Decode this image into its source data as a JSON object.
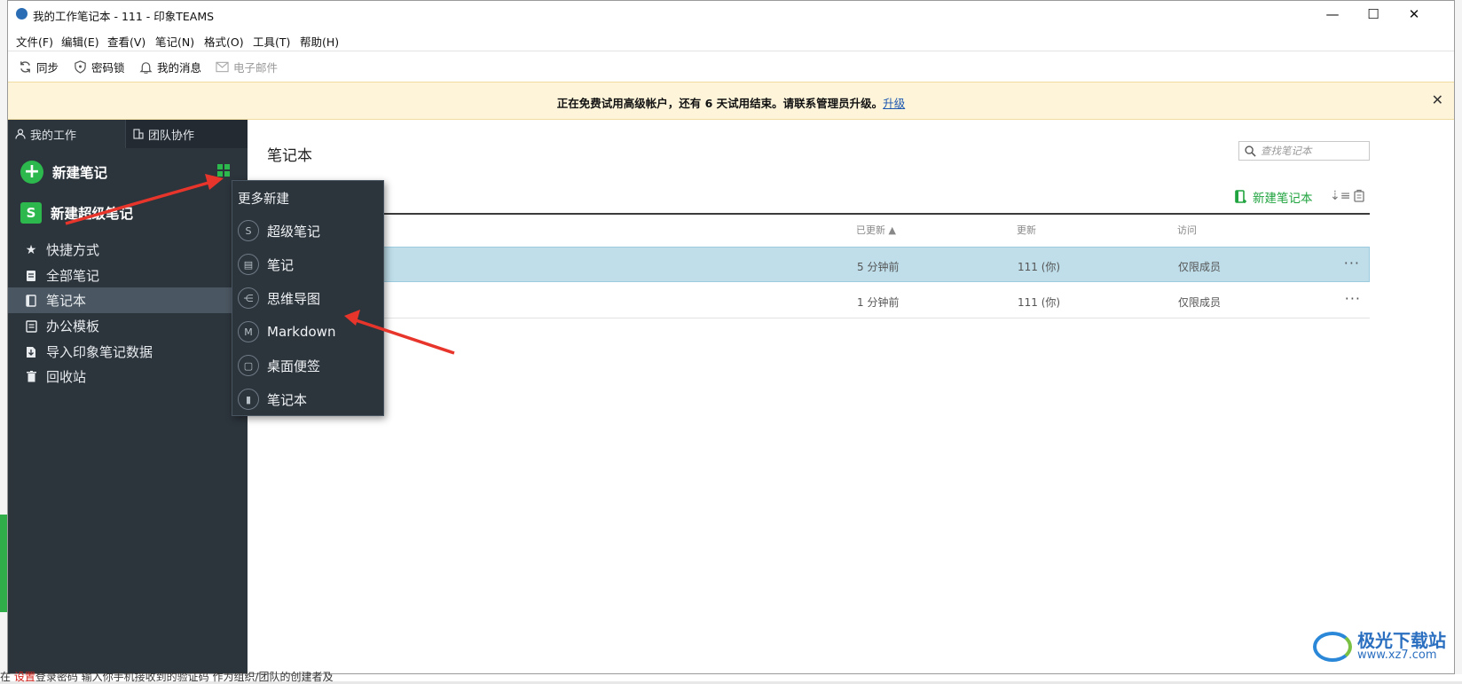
{
  "window": {
    "title": "我的工作笔记本 - 111 - 印象TEAMS",
    "controls": {
      "minimize": "—",
      "maximize": "☐",
      "close": "✕"
    }
  },
  "menubar": {
    "items": [
      "文件(F)",
      "编辑(E)",
      "查看(V)",
      "笔记(N)",
      "格式(O)",
      "工具(T)",
      "帮助(H)"
    ]
  },
  "toolbar": {
    "sync": "同步",
    "password_lock": "密码锁",
    "my_messages": "我的消息",
    "email": "电子邮件"
  },
  "banner": {
    "message": "正在免费试用高级帐户，还有 6 天试用结束。请联系管理员升级。",
    "link": "升级"
  },
  "sidebar": {
    "tabs": [
      "我的工作",
      "团队协作"
    ],
    "new_note": "新建笔记",
    "new_super_note": "新建超级笔记",
    "items": [
      {
        "label": "快捷方式",
        "icon": "star-icon"
      },
      {
        "label": "全部笔记",
        "icon": "notes-icon"
      },
      {
        "label": "笔记本",
        "icon": "notebook-icon"
      },
      {
        "label": "办公模板",
        "icon": "template-icon"
      },
      {
        "label": "导入印象笔记数据",
        "icon": "import-icon"
      },
      {
        "label": "回收站",
        "icon": "trash-icon"
      }
    ]
  },
  "dropdown": {
    "title": "更多新建",
    "items": [
      "超级笔记",
      "笔记",
      "思维导图",
      "Markdown",
      "桌面便签",
      "笔记本"
    ]
  },
  "main": {
    "title": "笔记本",
    "search_placeholder": "查找笔记本",
    "new_notebook": "新建笔记本",
    "columns": [
      "已更新 ▲",
      "更新",
      "访问"
    ],
    "rows": [
      {
        "updated": "5 分钟前",
        "updater": "111 (你)",
        "access": "仅限成员",
        "more": "···"
      },
      {
        "updated": "1 分钟前",
        "updater": "111 (你)",
        "access": "仅限成员",
        "more": "···"
      }
    ]
  },
  "background": {
    "bottom_text_pre": "在 ",
    "bottom_text_red": "设置",
    "bottom_text_post": "登录密码 输入你手机接收到的验证码 作为组织/团队的创建者及"
  },
  "watermark": {
    "name": "极光下载站",
    "url": "www.xz7.com"
  },
  "colors": {
    "accent_green": "#2db84d",
    "sidebar_bg": "#2c343c",
    "selected_row": "#bfdeea",
    "banner_bg": "#fdf4d9",
    "arrow_red": "#e8352b"
  }
}
